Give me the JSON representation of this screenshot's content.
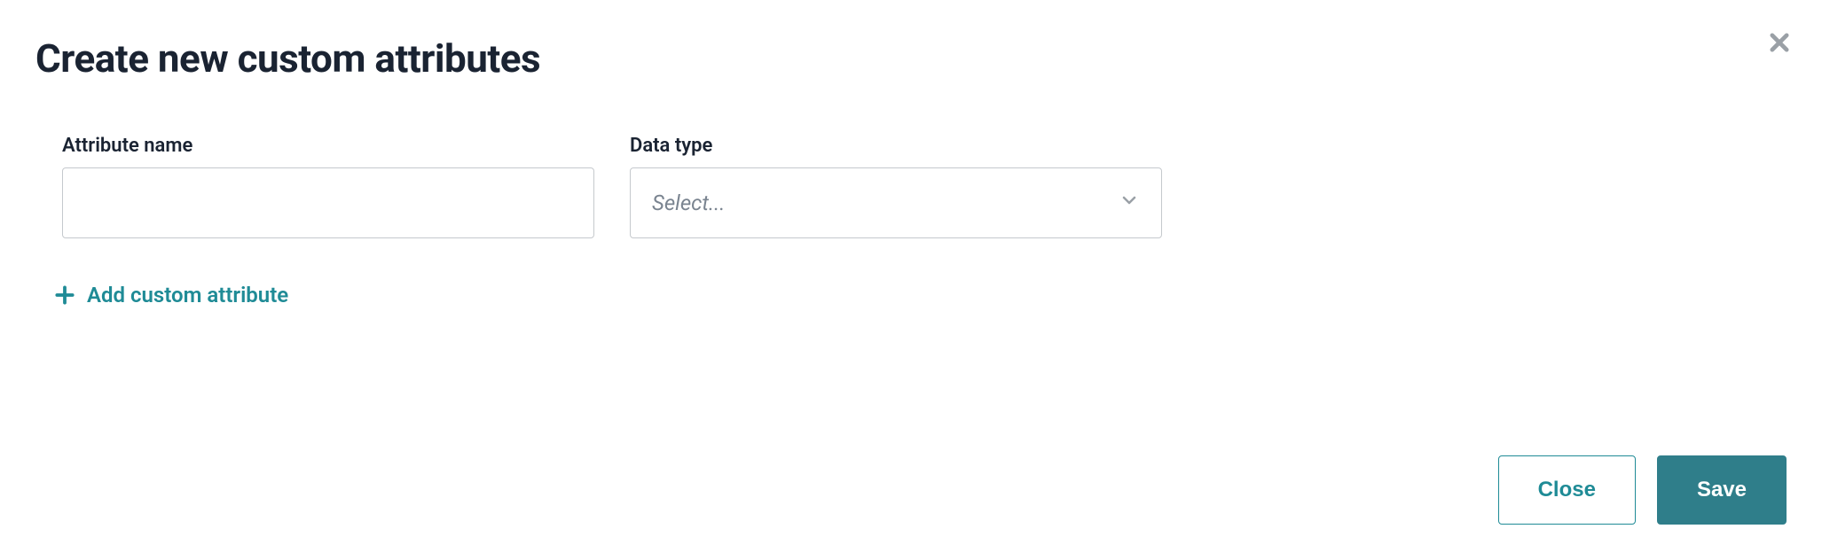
{
  "dialog": {
    "title": "Create new custom attributes"
  },
  "form": {
    "attribute_name": {
      "label": "Attribute name",
      "value": ""
    },
    "data_type": {
      "label": "Data type",
      "placeholder": "Select..."
    }
  },
  "actions": {
    "add_attribute_label": "Add custom attribute",
    "close_label": "Close",
    "save_label": "Save"
  }
}
